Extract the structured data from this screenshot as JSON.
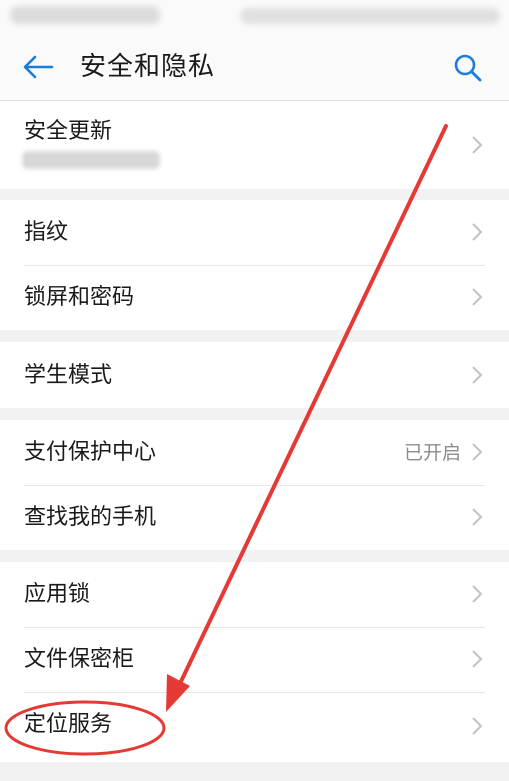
{
  "header": {
    "title": "安全和隐私",
    "back_icon": "arrow-left-icon",
    "search_icon": "search-icon"
  },
  "groups": [
    {
      "items": [
        {
          "label": "安全更新"
        }
      ]
    },
    {
      "items": [
        {
          "label": "指纹"
        },
        {
          "label": "锁屏和密码"
        }
      ]
    },
    {
      "items": [
        {
          "label": "学生模式"
        }
      ]
    },
    {
      "items": [
        {
          "label": "支付保护中心",
          "status": "已开启"
        },
        {
          "label": "查找我的手机"
        }
      ]
    },
    {
      "items": [
        {
          "label": "应用锁"
        },
        {
          "label": "文件保密柜"
        },
        {
          "label": "定位服务",
          "highlighted": true
        }
      ]
    }
  ],
  "colors": {
    "accent": "#1a7cdc",
    "annotation": "#e53935",
    "background": "#f2f2f2"
  }
}
